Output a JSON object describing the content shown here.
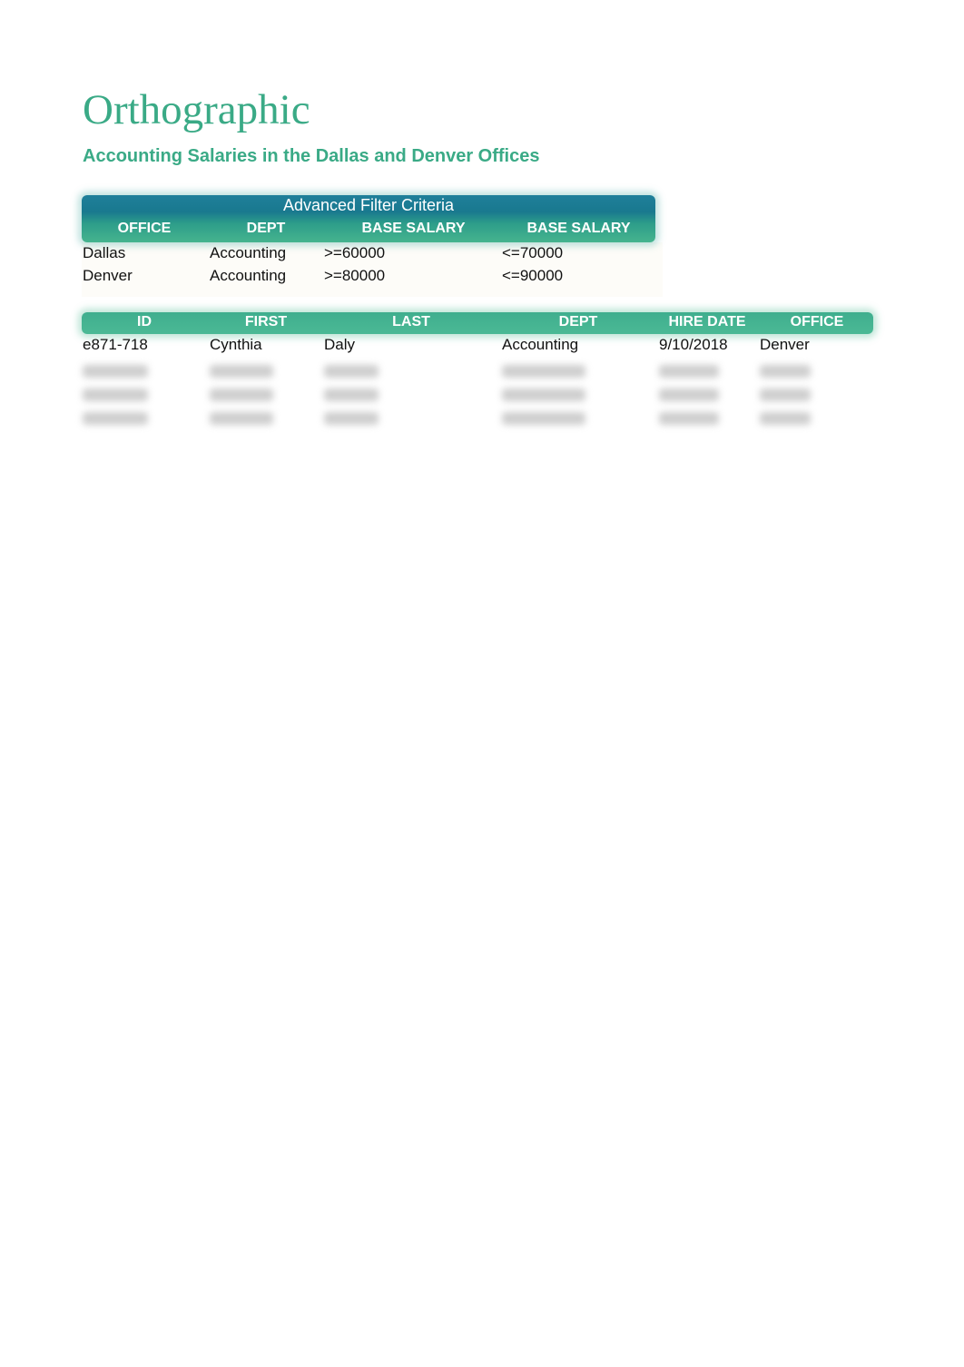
{
  "title": "Orthographic",
  "subtitle": "Accounting Salaries in the Dallas and Denver Offices",
  "criteria": {
    "title": "Advanced Filter Criteria",
    "headers": [
      "OFFICE",
      "DEPT",
      "BASE SALARY",
      "BASE SALARY"
    ],
    "rows": [
      [
        "Dallas",
        "Accounting",
        ">=60000",
        "<=70000"
      ],
      [
        "Denver",
        "Accounting",
        ">=80000",
        "<=90000"
      ]
    ]
  },
  "results": {
    "headers": [
      "ID",
      "FIRST",
      "LAST",
      "DEPT",
      "HIRE DATE",
      "OFFICE"
    ],
    "rows": [
      [
        "e871-718",
        "Cynthia",
        "Daly",
        "Accounting",
        "9/10/2018",
        "Denver"
      ]
    ],
    "blurred_rows": 3
  },
  "colors": {
    "accent": "#3aaa86",
    "header_dark": "#19798f"
  }
}
